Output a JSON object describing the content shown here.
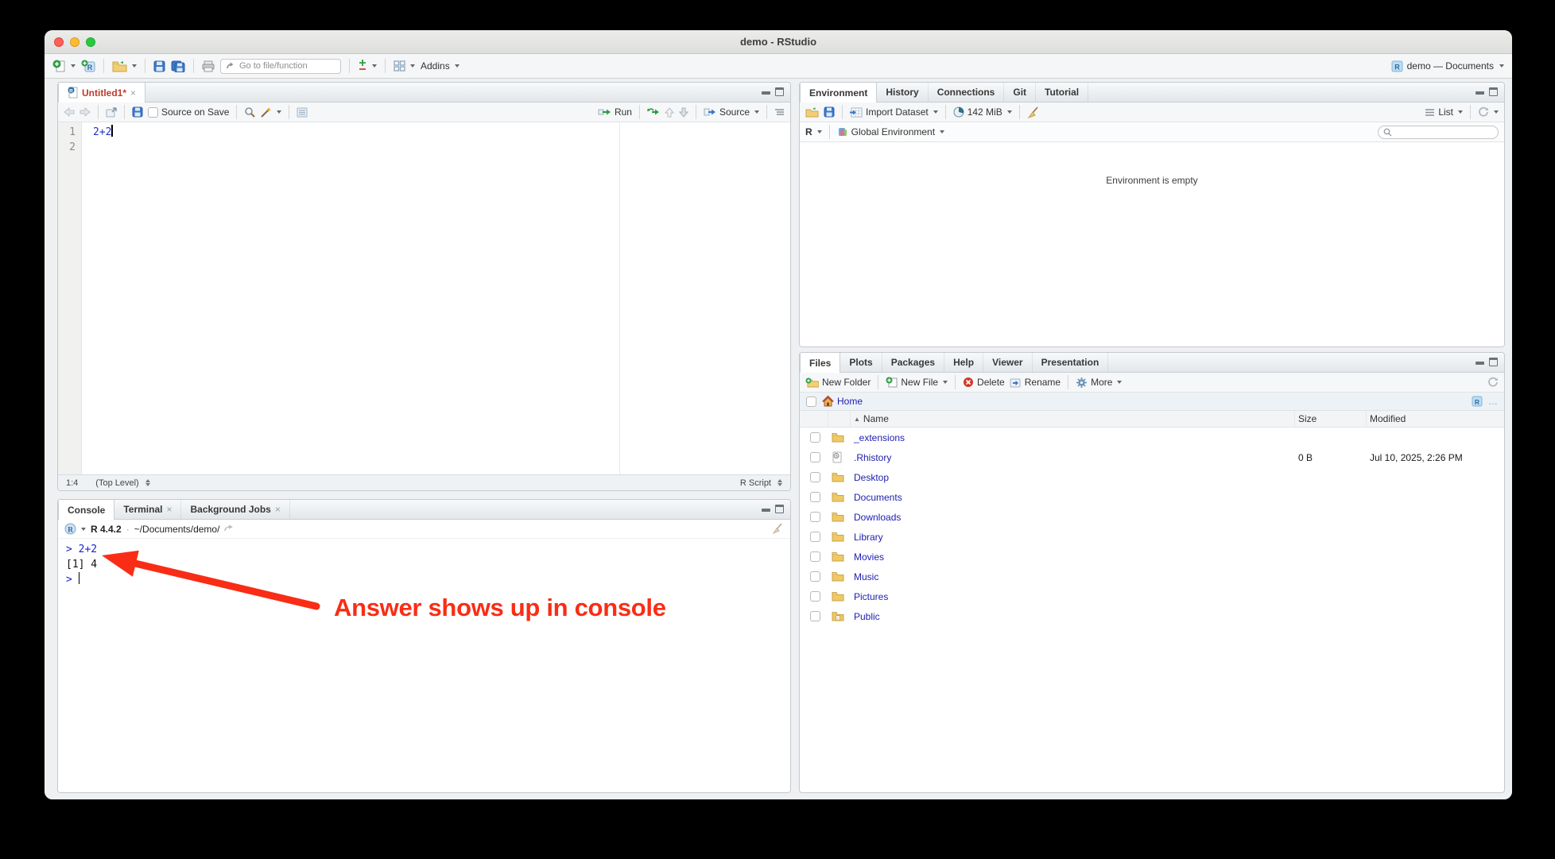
{
  "window": {
    "title": "demo - RStudio"
  },
  "toolbar": {
    "goto_placeholder": "Go to file/function",
    "addins_label": "Addins",
    "project_label": "demo — Documents"
  },
  "editor": {
    "tab_title": "Untitled1*",
    "toolbar": {
      "source_on_save": "Source on Save",
      "run": "Run",
      "source": "Source"
    },
    "lines": [
      {
        "num": "1",
        "code": "2+2"
      },
      {
        "num": "2",
        "code": ""
      }
    ],
    "status": {
      "position": "1:4",
      "scope": "(Top Level)",
      "type": "R Script"
    }
  },
  "console": {
    "tabs": [
      "Console",
      "Terminal",
      "Background Jobs"
    ],
    "header": {
      "version": "R 4.4.2",
      "dot": "·",
      "path": "~/Documents/demo/"
    },
    "input_line": "> 2+2",
    "output_line": "[1] 4",
    "prompt": ">"
  },
  "environment": {
    "tabs": [
      "Environment",
      "History",
      "Connections",
      "Git",
      "Tutorial"
    ],
    "toolbar": {
      "import": "Import Dataset",
      "memory": "142 MiB",
      "list": "List"
    },
    "row2": {
      "language": "R",
      "scope": "Global Environment"
    },
    "empty_message": "Environment is empty"
  },
  "files": {
    "tabs": [
      "Files",
      "Plots",
      "Packages",
      "Help",
      "Viewer",
      "Presentation"
    ],
    "toolbar": {
      "new_folder": "New Folder",
      "new_file": "New File",
      "delete": "Delete",
      "rename": "Rename",
      "more": "More"
    },
    "breadcrumb": {
      "home": "Home",
      "ellipsis": "…"
    },
    "columns": {
      "name": "Name",
      "size": "Size",
      "modified": "Modified"
    },
    "rows": [
      {
        "name": "_extensions",
        "size": "",
        "modified": ""
      },
      {
        "name": ".Rhistory",
        "size": "0 B",
        "modified": "Jul 10, 2025, 2:26 PM"
      },
      {
        "name": "Desktop",
        "size": "",
        "modified": ""
      },
      {
        "name": "Documents",
        "size": "",
        "modified": ""
      },
      {
        "name": "Downloads",
        "size": "",
        "modified": ""
      },
      {
        "name": "Library",
        "size": "",
        "modified": ""
      },
      {
        "name": "Movies",
        "size": "",
        "modified": ""
      },
      {
        "name": "Music",
        "size": "",
        "modified": ""
      },
      {
        "name": "Pictures",
        "size": "",
        "modified": ""
      },
      {
        "name": "Public",
        "size": "",
        "modified": ""
      }
    ]
  },
  "annotation": {
    "text": "Answer shows up in console"
  },
  "icons": {
    "close": "×",
    "sort_asc": "▲"
  },
  "colors": {
    "annotation_red": "#f92d15",
    "link_blue": "#1d1db0",
    "console_blue": "#1a24c8"
  }
}
